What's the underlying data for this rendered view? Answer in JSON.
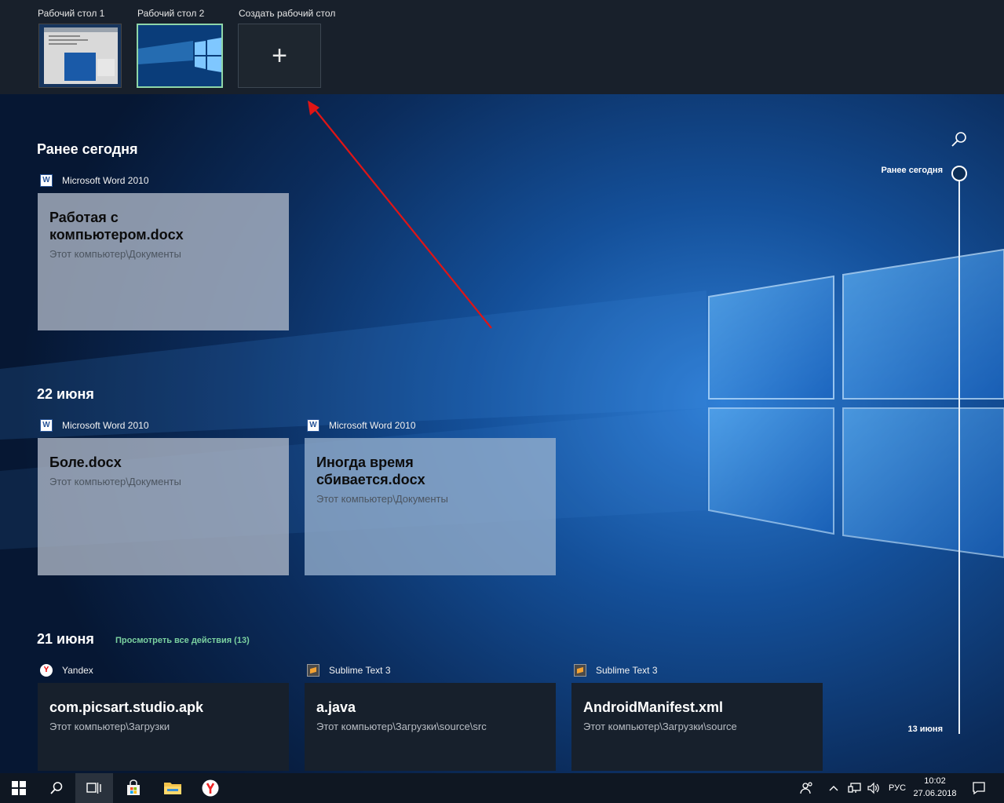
{
  "desktops": {
    "desktop1_label": "Рабочий стол 1",
    "desktop2_label": "Рабочий стол 2",
    "new_desktop_label": "Создать рабочий стол"
  },
  "sections": {
    "today": {
      "title": "Ранее сегодня",
      "app_name": "Microsoft Word 2010",
      "card_title": "Работая с компьютером.docx",
      "card_path": "Этот компьютер\\Документы"
    },
    "june22": {
      "title": "22 июня",
      "cards": [
        {
          "app_name": "Microsoft Word 2010",
          "title": "Боле.docx",
          "path": "Этот компьютер\\Документы"
        },
        {
          "app_name": "Microsoft Word 2010",
          "title": "Иногда время сбивается.docx",
          "path": "Этот компьютер\\Документы"
        }
      ]
    },
    "june21": {
      "title": "21 июня",
      "see_all": "Просмотреть все действия (13)",
      "cards": [
        {
          "app_name": "Yandex",
          "title": "com.picsart.studio.apk",
          "path": "Этот компьютер\\Загрузки"
        },
        {
          "app_name": "Sublime Text 3",
          "title": "a.java",
          "path": "Этот компьютер\\Загрузки\\source\\src"
        },
        {
          "app_name": "Sublime Text 3",
          "title": "AndroidManifest.xml",
          "path": "Этот компьютер\\Загрузки\\source"
        }
      ]
    }
  },
  "rail": {
    "top_label": "Ранее сегодня",
    "bottom_label": "13 июня"
  },
  "taskbar": {
    "language": "РУС",
    "time": "10:02",
    "date": "27.06.2018"
  },
  "colors": {
    "accent_green": "#7bd1a0",
    "annotation_arrow": "#e01515",
    "taskbar_bg": "#0f1722"
  }
}
